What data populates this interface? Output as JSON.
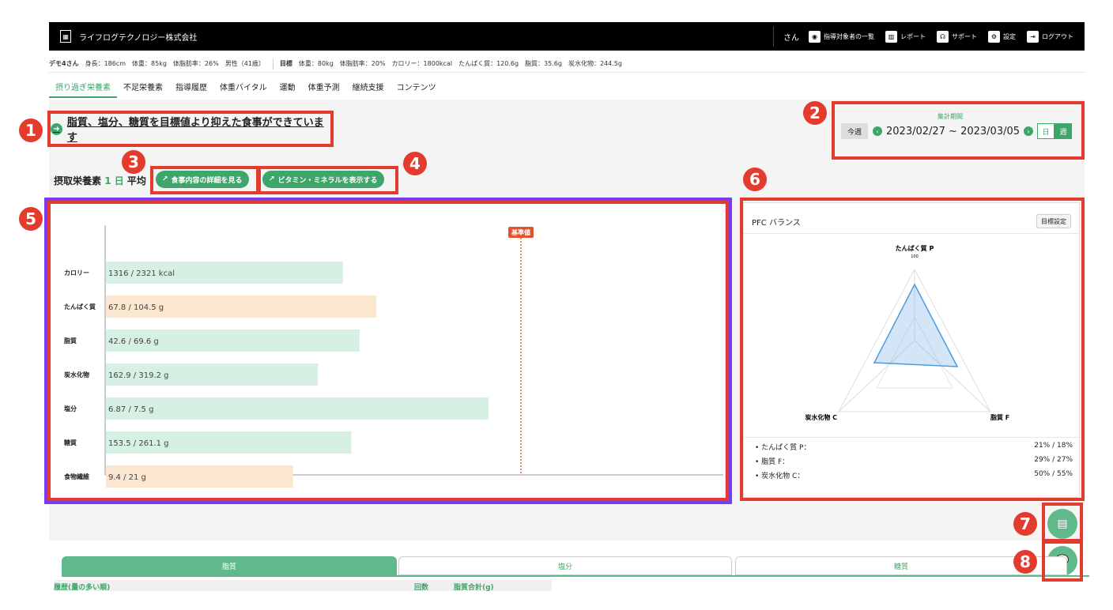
{
  "app": {
    "company": "ライフログテクノロジー株式会社",
    "user_suffix": "さん",
    "nav": [
      {
        "label": "指導対象者の一覧",
        "icon": "user-circle-icon"
      },
      {
        "label": "レポート",
        "icon": "report-chart-icon"
      },
      {
        "label": "サポート",
        "icon": "headset-icon"
      },
      {
        "label": "設定",
        "icon": "gear-icon"
      },
      {
        "label": "ログアウト",
        "icon": "logout-icon"
      }
    ]
  },
  "info": {
    "name": "デモ4さん",
    "profile": "身長：186cm　体重：85kg　体脂肪率：26%　男性（41歳）",
    "target_label": "目標",
    "targets": "体重：80kg　体脂肪率：20%　カロリー：1800kcal　たんぱく質：120.6g　脂質：35.6g　炭水化物：244.5g"
  },
  "tabs": [
    "摂り過ぎ栄養素",
    "不足栄養素",
    "指導履歴",
    "体重バイタル",
    "運動",
    "体重予測",
    "継続支援",
    "コンテンツ"
  ],
  "summary": "脂質、塩分、糖質を目標値より抑えた食事ができています",
  "period": {
    "label": "集計期間",
    "this_week": "今週",
    "range": "2023/02/27 ~ 2023/03/05",
    "day": "日",
    "week": "週"
  },
  "intake": {
    "prefix": "摂取栄養素",
    "unit": "1 日",
    "suffix": "平均"
  },
  "buttons": {
    "meal_detail": "食事内容の詳細を見る",
    "vitamin": "ビタミン・ミネラルを表示する"
  },
  "chart_data": {
    "type": "bar",
    "reference_label": "基準値",
    "categories": [
      "カロリー",
      "たんぱく質",
      "脂質",
      "炭水化物",
      "塩分",
      "糖質",
      "食物繊維"
    ],
    "labels": [
      "1316 / 2321 kcal",
      "67.8 / 104.5 g",
      "42.6 / 69.6 g",
      "162.9 / 319.2 g",
      "6.87 / 7.5 g",
      "153.5 / 261.1 g",
      "9.4 / 21 g"
    ],
    "values": [
      1316,
      67.8,
      42.6,
      162.9,
      6.87,
      153.5,
      9.4
    ],
    "targets": [
      2321,
      104.5,
      69.6,
      319.2,
      7.5,
      261.1,
      21
    ],
    "fill_ratio_of_reference": [
      0.57,
      0.65,
      0.61,
      0.51,
      0.92,
      0.59,
      0.45
    ],
    "status": [
      "ok",
      "low",
      "ok",
      "ok",
      "ok",
      "ok",
      "low"
    ],
    "colors": {
      "ok": "#d6f0e3",
      "low": "#fbe6cf",
      "reference": "#d9392b"
    }
  },
  "pfc": {
    "title": "PFC バランス",
    "target_button": "目標設定",
    "axes": [
      "たんぱく質 P",
      "脂質 F",
      "炭水化物 C"
    ],
    "scale_label": "100",
    "rows": [
      {
        "label": "たんぱく質 P：",
        "value": "21% / 18%"
      },
      {
        "label": "脂質 F：",
        "value": "29% / 27%"
      },
      {
        "label": "炭水化物 C：",
        "value": "50% / 55%"
      }
    ]
  },
  "annotations": [
    "1",
    "2",
    "3",
    "4",
    "5",
    "6",
    "7",
    "8"
  ],
  "bottom": {
    "tabs": [
      "脂質",
      "塩分",
      "糖質"
    ],
    "history_label": "履歴(量の多い順)",
    "col_count": "回数",
    "col_total": "脂質合計(g)"
  }
}
